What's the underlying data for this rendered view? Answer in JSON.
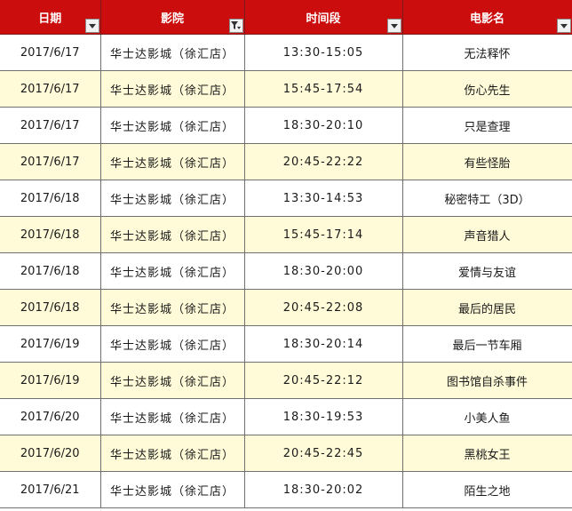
{
  "headers": [
    {
      "label": "日期",
      "icon": "dropdown-arrow-icon"
    },
    {
      "label": "影院",
      "icon": "filter-applied-icon"
    },
    {
      "label": "时间段",
      "icon": "dropdown-arrow-icon"
    },
    {
      "label": "电影名",
      "icon": "dropdown-arrow-icon"
    }
  ],
  "rows": [
    [
      "2017/6/17",
      "华士达影城（徐汇店）",
      "13:30-15:05",
      "无法释怀"
    ],
    [
      "2017/6/17",
      "华士达影城（徐汇店）",
      "15:45-17:54",
      "伤心先生"
    ],
    [
      "2017/6/17",
      "华士达影城（徐汇店）",
      "18:30-20:10",
      "只是查理"
    ],
    [
      "2017/6/17",
      "华士达影城（徐汇店）",
      "20:45-22:22",
      "有些怪胎"
    ],
    [
      "2017/6/18",
      "华士达影城（徐汇店）",
      "13:30-14:53",
      "秘密特工（3D）"
    ],
    [
      "2017/6/18",
      "华士达影城（徐汇店）",
      "15:45-17:14",
      "声音猎人"
    ],
    [
      "2017/6/18",
      "华士达影城（徐汇店）",
      "18:30-20:00",
      "爱情与友谊"
    ],
    [
      "2017/6/18",
      "华士达影城（徐汇店）",
      "20:45-22:08",
      "最后的居民"
    ],
    [
      "2017/6/19",
      "华士达影城（徐汇店）",
      "18:30-20:14",
      "最后一节车厢"
    ],
    [
      "2017/6/19",
      "华士达影城（徐汇店）",
      "20:45-22:12",
      "图书馆自杀事件"
    ],
    [
      "2017/6/20",
      "华士达影城（徐汇店）",
      "18:30-19:53",
      "小美人鱼"
    ],
    [
      "2017/6/20",
      "华士达影城（徐汇店）",
      "20:45-22:45",
      "黑桃女王"
    ],
    [
      "2017/6/21",
      "华士达影城（徐汇店）",
      "18:30-20:02",
      "陌生之地"
    ]
  ],
  "colors": {
    "header_bg": "#cc0d0d",
    "header_text": "#ffffff",
    "band_row_bg": "#fffbd8",
    "row_bg": "#ffffff"
  }
}
